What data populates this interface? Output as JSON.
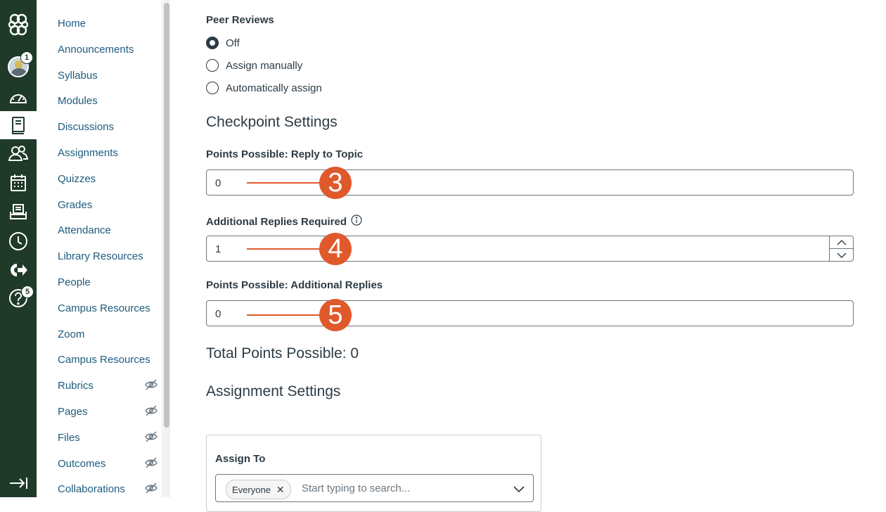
{
  "global_nav": {
    "items": [
      {
        "name": "logo-icon"
      },
      {
        "name": "account-avatar",
        "badge": "1"
      },
      {
        "name": "dashboard-icon"
      },
      {
        "name": "courses-icon"
      },
      {
        "name": "groups-icon"
      },
      {
        "name": "calendar-icon"
      },
      {
        "name": "inbox-icon"
      },
      {
        "name": "history-icon"
      },
      {
        "name": "commons-icon"
      },
      {
        "name": "help-icon",
        "badge": "5"
      },
      {
        "name": "collapse-nav-icon"
      }
    ]
  },
  "course_nav": {
    "items": [
      {
        "label": "Home",
        "hidden": false
      },
      {
        "label": "Announcements",
        "hidden": false
      },
      {
        "label": "Syllabus",
        "hidden": false
      },
      {
        "label": "Modules",
        "hidden": false
      },
      {
        "label": "Discussions",
        "hidden": false
      },
      {
        "label": "Assignments",
        "hidden": false
      },
      {
        "label": "Quizzes",
        "hidden": false
      },
      {
        "label": "Grades",
        "hidden": false
      },
      {
        "label": "Attendance",
        "hidden": false
      },
      {
        "label": "Library Resources",
        "hidden": false
      },
      {
        "label": "People",
        "hidden": false
      },
      {
        "label": "Campus Resources",
        "hidden": false
      },
      {
        "label": "Zoom",
        "hidden": false
      },
      {
        "label": "Campus Resources",
        "hidden": false
      },
      {
        "label": "Rubrics",
        "hidden": true
      },
      {
        "label": "Pages",
        "hidden": true
      },
      {
        "label": "Files",
        "hidden": true
      },
      {
        "label": "Outcomes",
        "hidden": true
      },
      {
        "label": "Collaborations",
        "hidden": true
      }
    ]
  },
  "peer_reviews": {
    "title": "Peer Reviews",
    "options": [
      "Off",
      "Assign manually",
      "Automatically assign"
    ],
    "selected": "Off"
  },
  "checkpoint": {
    "title": "Checkpoint Settings",
    "reply_points_label": "Points Possible: Reply to Topic",
    "reply_points_value": "0",
    "additional_replies_label": "Additional Replies Required",
    "additional_replies_value": "1",
    "additional_points_label": "Points Possible: Additional Replies",
    "additional_points_value": "0",
    "total_label": "Total Points Possible: 0"
  },
  "callouts": [
    "3",
    "4",
    "5"
  ],
  "assignment_settings": {
    "title": "Assignment Settings",
    "assign_to_label": "Assign To",
    "chip_label": "Everyone",
    "search_placeholder": "Start typing to search..."
  },
  "colors": {
    "nav_bg": "#1f3a29",
    "link": "#1d5b7e",
    "callout": "#e0592b"
  }
}
